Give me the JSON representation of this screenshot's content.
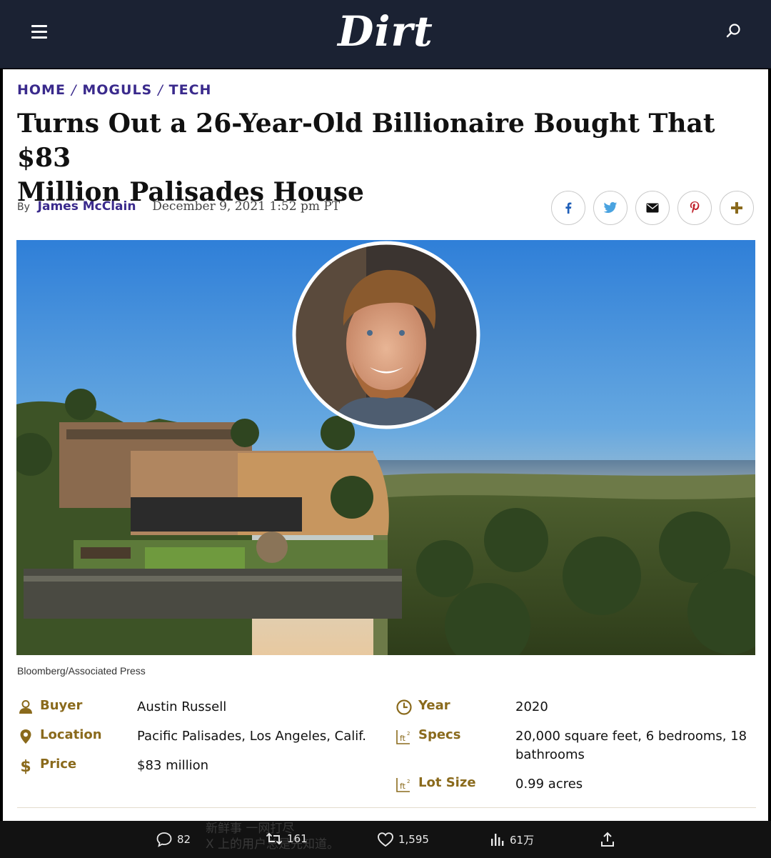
{
  "header": {
    "logo": "Dirt"
  },
  "breadcrumb": {
    "items": [
      "HOME",
      "MOGULS",
      "TECH"
    ],
    "separator": "/"
  },
  "headline": {
    "line1": "Turns Out a 26-Year-Old Billionaire Bought That $83",
    "line2": "Million Palisades House"
  },
  "byline": {
    "by": "By",
    "author": "James McClain",
    "date": "December 9, 2021 1:52 pm PT"
  },
  "share": {
    "icons": [
      "facebook-icon",
      "twitter-icon",
      "email-icon",
      "pinterest-icon",
      "plus-icon"
    ],
    "colors": {
      "facebook": "#1f5fb8",
      "twitter": "#4aa3e0",
      "email": "#111111",
      "pinterest": "#c0202a",
      "plus": "#8a6a1c"
    }
  },
  "hero": {
    "caption": "Bloomberg/Associated Press"
  },
  "details": {
    "buyer_label": "Buyer",
    "buyer_value": "Austin Russell",
    "location_label": "Location",
    "location_value": "Pacific Palisades, Los Angeles, Calif.",
    "price_label": "Price",
    "price_value": "$83 million",
    "year_label": "Year",
    "year_value": "2020",
    "specs_label": "Specs",
    "specs_value": "20,000 square feet, 6 bedrooms, 18 bathrooms",
    "lot_label": "Lot Size",
    "lot_value": "0.99 acres"
  },
  "bottom_bar": {
    "replies": "82",
    "reposts": "161",
    "likes": "1,595",
    "views": "61万",
    "overlay_line1": "新鲜事 一网打尽",
    "overlay_line2": "X 上的用户总是先知道。"
  },
  "colors": {
    "header_bg": "#1b2233",
    "breadcrumb": "#3a2a8c",
    "detail_label": "#8a6a1c"
  }
}
